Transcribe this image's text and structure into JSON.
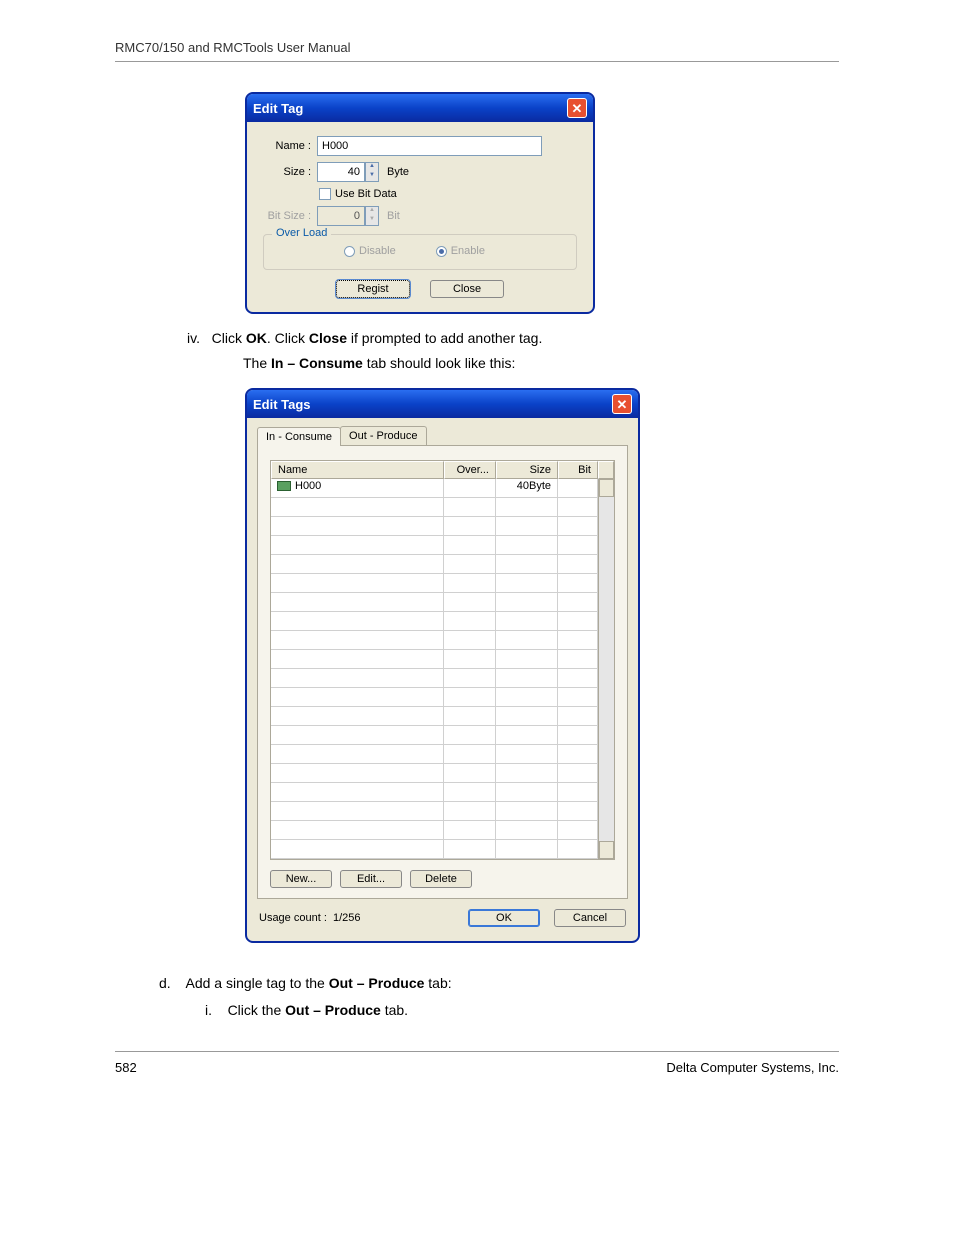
{
  "header": "RMC70/150 and RMCTools User Manual",
  "footer": {
    "page": "582",
    "company": "Delta Computer Systems, Inc."
  },
  "dialog1": {
    "title": "Edit Tag",
    "name_label": "Name :",
    "name_value": "H000",
    "size_label": "Size :",
    "size_value": "40",
    "size_unit": "Byte",
    "use_bit_data": "Use Bit Data",
    "bitsize_label": "Bit Size :",
    "bitsize_value": "0",
    "bitsize_unit": "Bit",
    "overload_legend": "Over Load",
    "disable": "Disable",
    "enable": "Enable",
    "regist": "Regist",
    "close": "Close"
  },
  "step_iv_a": "iv.",
  "step_iv_text1": "Click ",
  "step_iv_ok": "OK",
  "step_iv_text2": ". Click ",
  "step_iv_close": "Close",
  "step_iv_text3": " if prompted to add another tag.",
  "step_iv_line2a": "The ",
  "step_iv_tabname": "In – Consume",
  "step_iv_line2b": " tab should look like this:",
  "dialog2": {
    "title": "Edit Tags",
    "tab1": "In - Consume",
    "tab2": "Out - Produce",
    "cols": {
      "name": "Name",
      "over": "Over...",
      "size": "Size",
      "bit": "Bit"
    },
    "row1": {
      "name": "H000",
      "size": "40Byte"
    },
    "new": "New...",
    "edit": "Edit...",
    "delete": "Delete",
    "usage_label": "Usage count :",
    "usage_value": "1/256",
    "ok": "OK",
    "cancel": "Cancel"
  },
  "step_d_marker": "d.",
  "step_d_text1": "Add a single tag to the ",
  "step_d_bold": "Out – Produce",
  "step_d_text2": " tab:",
  "step_i_marker": "i.",
  "step_i_text1": "Click the ",
  "step_i_bold": "Out – Produce",
  "step_i_text2": " tab."
}
